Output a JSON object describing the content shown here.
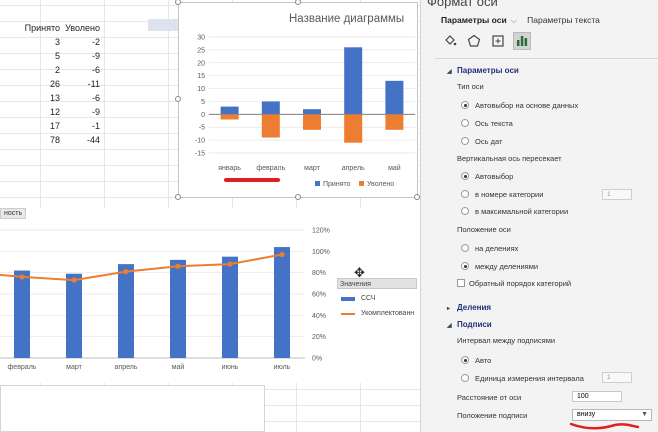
{
  "sheet": {
    "headers": [
      "Принято",
      "Уволено"
    ],
    "rows": [
      [
        "3",
        "-2"
      ],
      [
        "5",
        "-9"
      ],
      [
        "2",
        "-6"
      ],
      [
        "26",
        "-11"
      ],
      [
        "13",
        "-6"
      ],
      [
        "12",
        "-9"
      ],
      [
        "17",
        "-1"
      ],
      [
        "78",
        "-44"
      ]
    ]
  },
  "chart_data": [
    {
      "type": "bar",
      "title": "Название диаграммы",
      "categories": [
        "январь",
        "февраль",
        "март",
        "апрель",
        "май"
      ],
      "series": [
        {
          "name": "Принято",
          "values": [
            3,
            5,
            2,
            26,
            13
          ],
          "color": "#4472c4"
        },
        {
          "name": "Уволено",
          "values": [
            -2,
            -9,
            -6,
            -11,
            -6
          ],
          "color": "#ed7d31"
        }
      ],
      "y_ticks": [
        "30",
        "25",
        "20",
        "15",
        "10",
        "5",
        "0",
        "-5",
        "-10",
        "-15"
      ],
      "ylim": [
        -15,
        30
      ],
      "legend": "bottom"
    },
    {
      "type": "bar",
      "categories": [
        "февраль",
        "март",
        "апрель",
        "май",
        "июнь",
        "июль"
      ],
      "series": [
        {
          "name": "ССЧ",
          "values": [
            0.82,
            0.79,
            0.88,
            0.92,
            0.95,
            1.04
          ],
          "color": "#4472c4"
        },
        {
          "name": "Укомплектованн",
          "values": [
            0.76,
            0.73,
            0.81,
            0.86,
            0.88,
            0.97
          ],
          "color": "#ed7d31",
          "type": "line"
        }
      ],
      "y2_ticks": [
        "120%",
        "100%",
        "80%",
        "60%",
        "40%",
        "20%",
        "0%"
      ],
      "y2lim": [
        0,
        1.2
      ],
      "legend_title": "Значения",
      "tag": "ность"
    }
  ],
  "pane": {
    "title": "Формат оси",
    "tab_axis": "Параметры оси",
    "tab_text": "Параметры текста",
    "icons": [
      "fill-icon",
      "pentagon-icon",
      "size-icon",
      "bar-chart-icon"
    ],
    "sec_axis": "Параметры оси",
    "axis_type_label": "Тип оси",
    "axis_type_options": [
      "Автовыбор на основе данных",
      "Ось текста",
      "Ось дат"
    ],
    "cross_label": "Вертикальная ось пересекает",
    "cross_options": [
      "Автовыбор",
      "в номере категории",
      "в максимальной категории"
    ],
    "cross_value": "1",
    "position_label": "Положение оси",
    "position_options": [
      "на делениях",
      "между делениями"
    ],
    "reverse_label": "Обратный порядок категорий",
    "sec_ticks": "Деления",
    "sec_labels": "Подписи",
    "interval_label": "Интервал между подписями",
    "interval_options": [
      "Авто",
      "Единица измерения интервала"
    ],
    "interval_value": "1",
    "distance_label": "Расстояние от оси",
    "distance_value": "100",
    "label_pos_label": "Положение подписи",
    "label_pos_value": "внизу"
  },
  "colors": {
    "accent_blue": "#4472c4",
    "accent_orange": "#ed7d31",
    "annotation_red": "#e02020"
  }
}
